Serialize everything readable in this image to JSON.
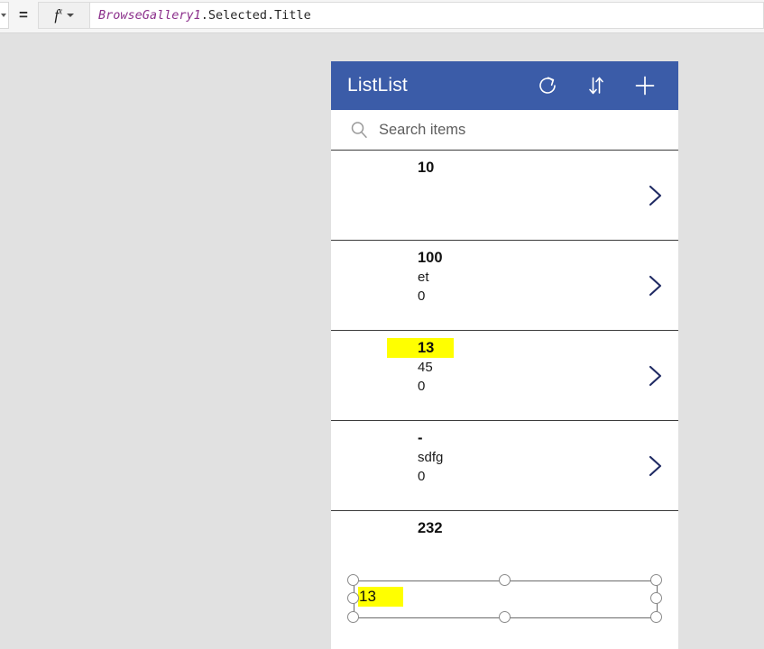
{
  "formula_bar": {
    "property_selector_value": "",
    "equals_label": "=",
    "fx_label": "fx",
    "formula_identifier": "BrowseGallery1",
    "formula_rest": ".Selected.Title",
    "formula_full": "BrowseGallery1.Selected.Title"
  },
  "app": {
    "title": "ListList",
    "header_color": "#3b5ca8",
    "icons": [
      {
        "name": "refresh-icon",
        "label": "Refresh"
      },
      {
        "name": "sort-icon",
        "label": "Sort"
      },
      {
        "name": "add-icon",
        "label": "Add"
      }
    ],
    "search": {
      "placeholder": "Search items",
      "value": ""
    },
    "gallery": {
      "items": [
        {
          "title": "10",
          "subtitle": "",
          "subtitle2": "",
          "highlighted": false
        },
        {
          "title": "100",
          "subtitle": "et",
          "subtitle2": "0",
          "highlighted": false
        },
        {
          "title": "13",
          "subtitle": "45",
          "subtitle2": "0",
          "highlighted": true
        },
        {
          "title": "-",
          "subtitle": "sdfg",
          "subtitle2": "0",
          "highlighted": false
        },
        {
          "title": "232",
          "subtitle": "",
          "subtitle2": "",
          "highlighted": false
        }
      ]
    }
  },
  "selection": {
    "label_text": "13",
    "highlight_color": "#ffff00",
    "handle_count": 8
  },
  "colors": {
    "canvas": "#e1e1e1",
    "accent": "#3b5ca8",
    "chevron": "#1f2a63",
    "formula_identifier": "#8b2f8b",
    "highlight": "#ffff00"
  }
}
